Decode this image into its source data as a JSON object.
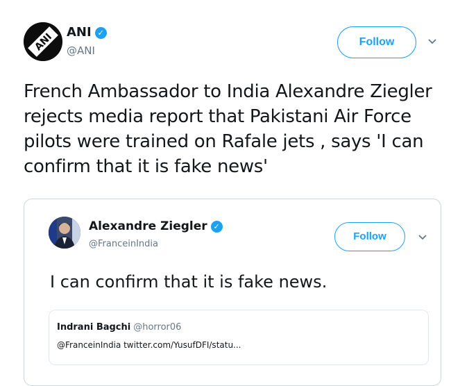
{
  "tweet": {
    "author_name": "ANI",
    "author_handle": "@ANI",
    "avatar_text": "ANI",
    "follow_label": "Follow",
    "text": "French Ambassador to India Alexandre Ziegler rejects media report that Pakistani Air Force pilots were trained on Rafale jets , says 'I can confirm that it is fake news'"
  },
  "quoted_tweet": {
    "author_name": "Alexandre Ziegler",
    "author_handle": "@FranceinIndia",
    "follow_label": "Follow",
    "text": "I can confirm that it is fake news.",
    "nested": {
      "author_name": "Indrani Bagchi",
      "author_handle": "@horror06",
      "link_text": "@FranceinIndia twitter.com/YusufDFI/statu..."
    }
  },
  "colors": {
    "accent": "#1da1f2",
    "text": "#14171a",
    "secondary": "#657786",
    "border": "#ccd6dd"
  },
  "icons": {
    "verified": "verified-badge-icon",
    "chevron": "chevron-down-icon"
  }
}
